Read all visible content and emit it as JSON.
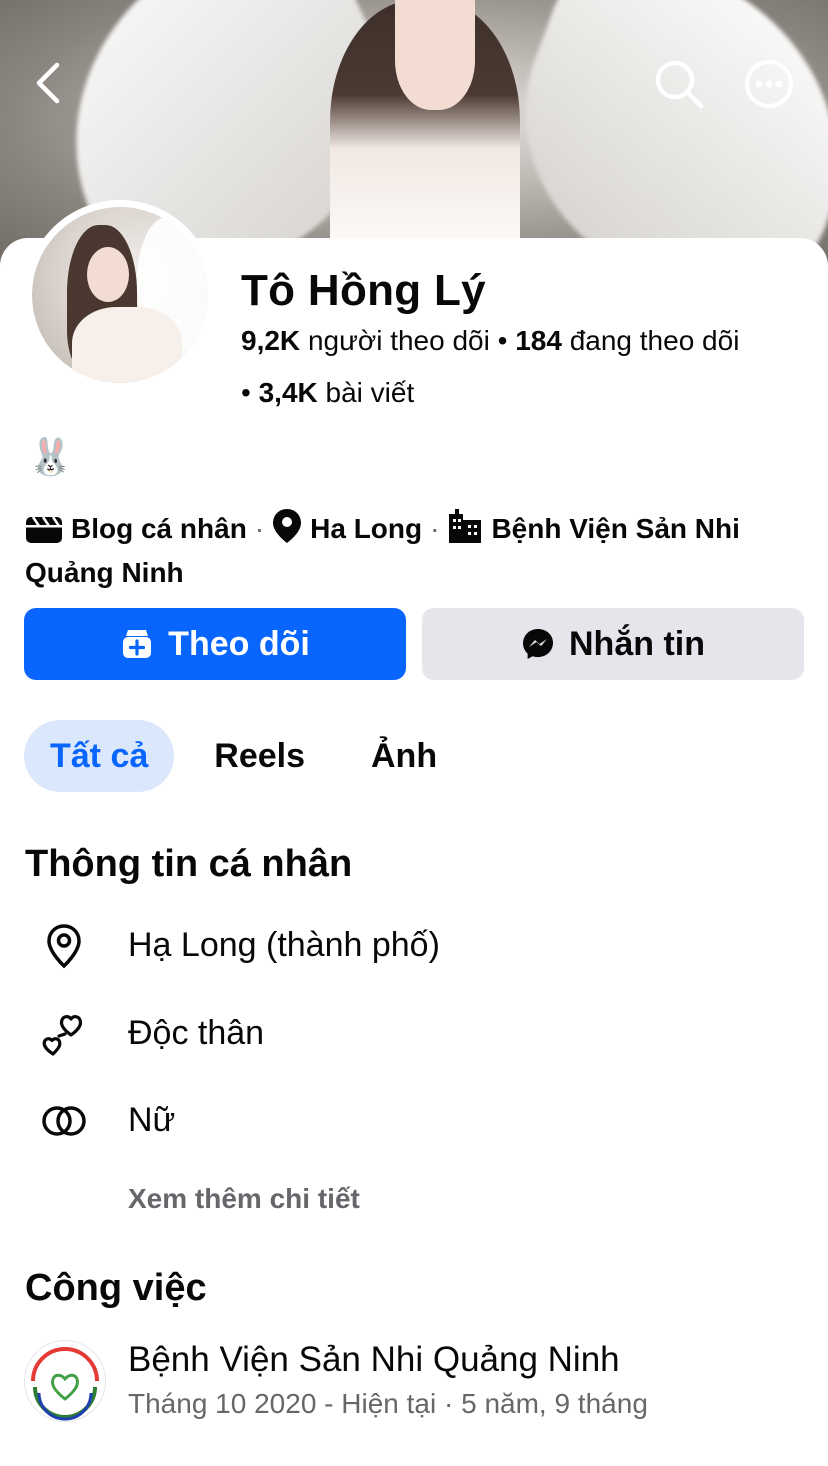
{
  "header": {
    "back_icon": "chevron-left-icon",
    "search_icon": "search-icon",
    "more_icon": "more-horizontal-icon"
  },
  "profile": {
    "name": "Tô Hồng Lý",
    "followers_count": "9,2K",
    "followers_label": "người theo dõi",
    "following_count": "184",
    "following_label": "đang theo dõi",
    "posts_count": "3,4K",
    "posts_label": "bài viết",
    "bio_emoji": "🐰"
  },
  "meta": {
    "category": "Blog cá nhân",
    "location": "Ha Long",
    "workplace": "Bệnh Viện Sản Nhi Quảng Ninh"
  },
  "actions": {
    "follow_label": "Theo dõi",
    "message_label": "Nhắn tin",
    "follow_color": "#0866ff",
    "message_bg": "#e4e6eb"
  },
  "tabs": [
    {
      "label": "Tất cả",
      "active": true
    },
    {
      "label": "Reels",
      "active": false
    },
    {
      "label": "Ảnh",
      "active": false
    }
  ],
  "personal_info": {
    "title": "Thông tin cá nhân",
    "city": "Hạ Long (thành phố)",
    "relationship": "Độc thân",
    "gender": "Nữ",
    "see_more": "Xem thêm chi tiết"
  },
  "work": {
    "title": "Công việc",
    "employer": "Bệnh Viện Sản Nhi Quảng Ninh",
    "period": "Tháng 10 2020 - Hiện tại · 5 năm, 9 tháng"
  }
}
